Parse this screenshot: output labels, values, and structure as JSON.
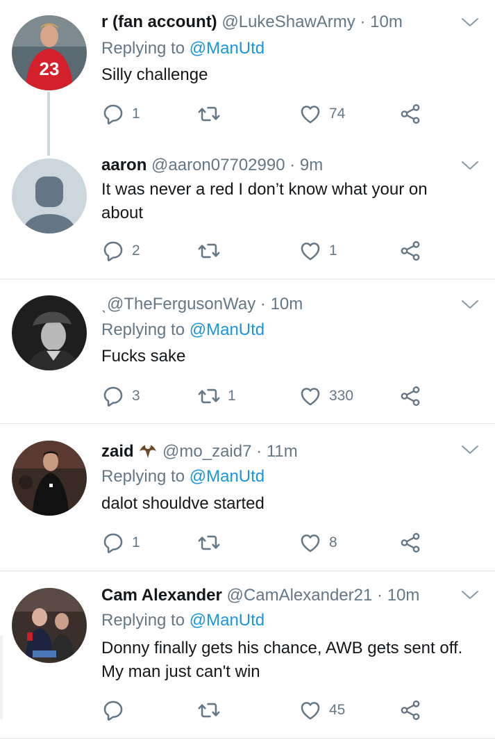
{
  "tweets": [
    {
      "name": "r (fan account)",
      "handle": "@LukeShawArmy",
      "time": "10m",
      "replying_prefix": "Replying to",
      "replying_to": "@ManUtd",
      "text": "Silly challenge",
      "replies": "1",
      "retweets": "",
      "likes": "74",
      "avatar": "football-player-red-kit-icon"
    },
    {
      "name": "aaron",
      "handle": "@aaron07702990",
      "time": "9m",
      "text": "It was never a red I don’t know what your on about",
      "replies": "2",
      "retweets": "",
      "likes": "1",
      "avatar": "default-user-icon"
    },
    {
      "name": "ˎ",
      "handle": "@TheFergusonWay",
      "time": "10m",
      "replying_prefix": "Replying to",
      "replying_to": "@ManUtd",
      "text": "Fucks sake",
      "replies": "3",
      "retweets": "1",
      "likes": "330",
      "avatar": "man-in-flat-cap-icon"
    },
    {
      "name": "zaid",
      "handle": "@mo_zaid7",
      "time": "11m",
      "replying_prefix": "Replying to",
      "replying_to": "@ManUtd",
      "text": "dalot shouldve started",
      "replies": "1",
      "retweets": "",
      "likes": "8",
      "avatar": "player-black-kit-icon",
      "name_emoji": "eagle-emoji"
    },
    {
      "name": "Cam Alexander",
      "handle": "@CamAlexander21",
      "time": "10m",
      "replying_prefix": "Replying to",
      "replying_to": "@ManUtd",
      "text": "Donny finally gets his chance, AWB gets sent off. My man just can't win",
      "replies": "",
      "retweets": "",
      "likes": "45",
      "avatar": "two-people-photo-icon"
    }
  ],
  "colors": {
    "text": "#14171a",
    "secondary": "#657786",
    "link": "#1b95e0",
    "divider": "#e1e8ed",
    "thread_line": "#ccd6dd"
  },
  "dot": "·"
}
